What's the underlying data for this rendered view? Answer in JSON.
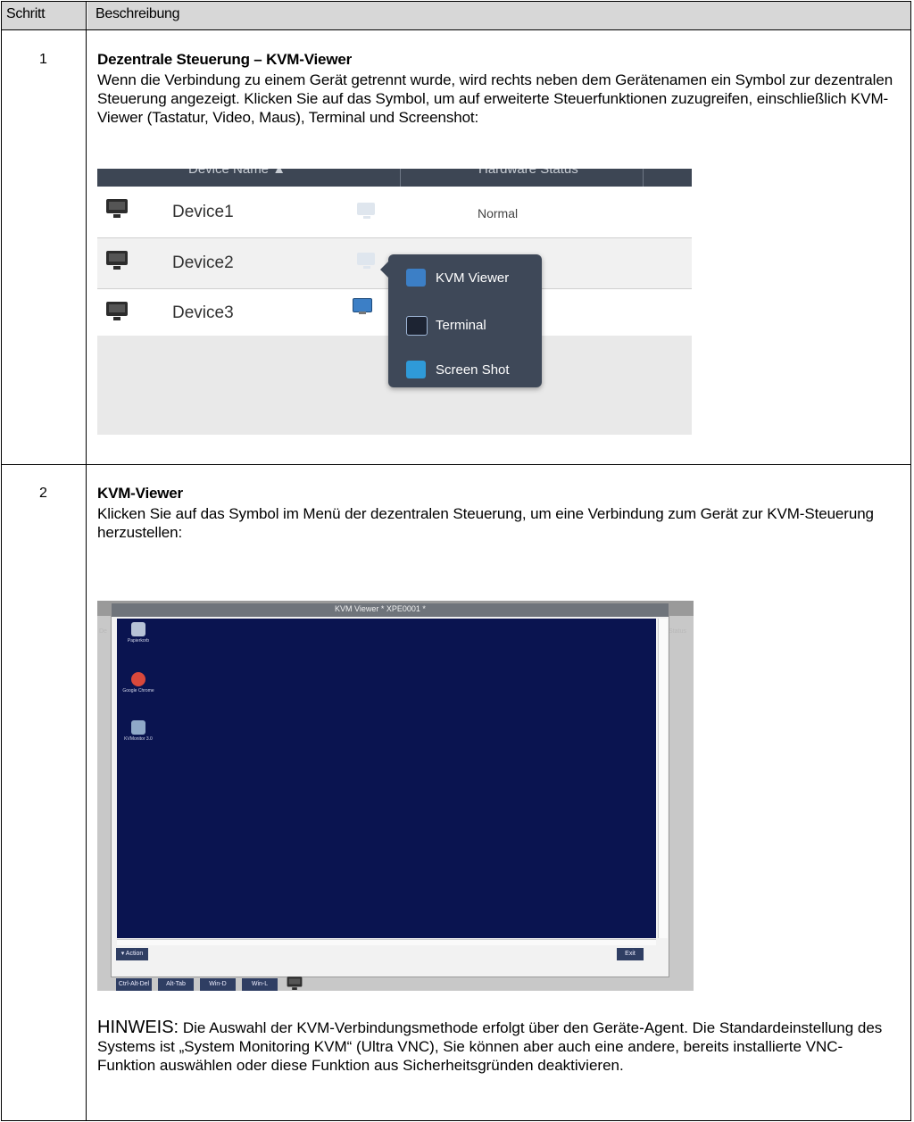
{
  "table": {
    "header": {
      "col1": "Schritt",
      "col2": "Beschreibung"
    }
  },
  "step1": {
    "number": "1",
    "title": "Dezentrale Steuerung – KVM-Viewer",
    "text": "Wenn die Verbindung zu einem Gerät getrennt wurde, wird rechts neben dem Gerätenamen ein Symbol zur dezentralen Steuerung angezeigt. Klicken Sie auf das Symbol, um auf erweiterte Steuerfunktionen zuzugreifen, einschließlich KVM-Viewer (Tastatur, Video, Maus), Terminal und Screenshot:",
    "screenshot": {
      "columns": [
        "Device Name ▲",
        "Hardware Status"
      ],
      "devices": [
        {
          "name": "Device1",
          "status": "Normal"
        },
        {
          "name": "Device2",
          "status": ""
        },
        {
          "name": "Device3",
          "status": ""
        }
      ],
      "menu": [
        "KVM Viewer",
        "Terminal",
        "Screen Shot"
      ]
    }
  },
  "step2": {
    "number": "2",
    "title": "KVM-Viewer",
    "text": "Klicken Sie auf das Symbol im Menü der dezentralen Steuerung, um eine Verbindung zum Gerät zur KVM-Steuerung herzustellen:",
    "screenshot": {
      "window_title": "KVM Viewer * XPE0001 *",
      "desktop_icons": [
        "Papierkorb",
        "Google Chrome",
        "KVMonitor 3.0"
      ],
      "action_button": "▾  Action",
      "exit_button": "Exit",
      "toolbar_buttons": [
        "Ctrl-Alt-Del",
        "Alt-Tab",
        "Win-D",
        "Win-L"
      ]
    },
    "note_label": "HINWEIS:",
    "note_text": "Die Auswahl der KVM-Verbindungsmethode erfolgt über den Geräte-Agent. Die Standardeinstellung des Systems ist „System Monitoring KVM“ (Ultra VNC), Sie können aber auch eine andere, bereits installierte VNC-Funktion auswählen oder diese Funktion aus Sicherheitsgründen deaktivieren."
  }
}
